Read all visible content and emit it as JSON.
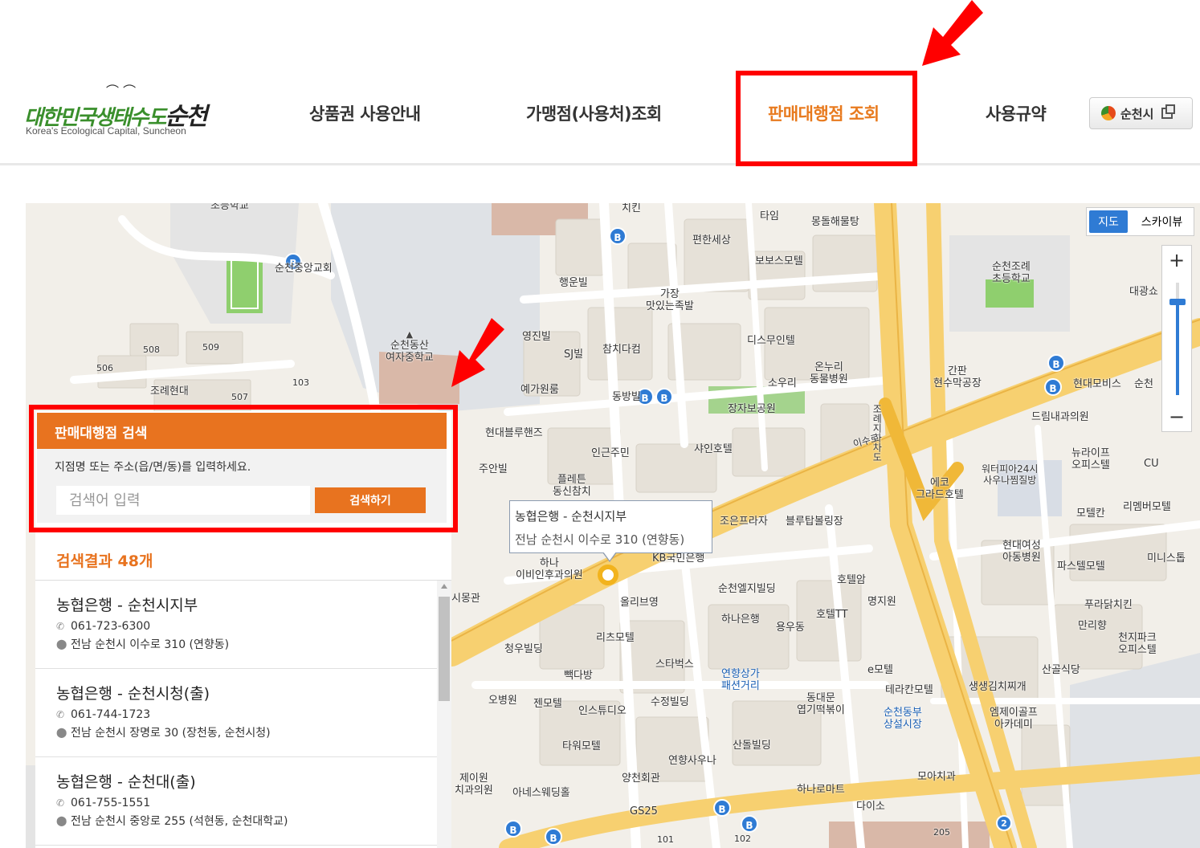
{
  "header": {
    "logo": {
      "title_green": "대한민국생태수도",
      "title_dark": "순천",
      "subtitle": "Korea's Ecological Capital, Suncheon"
    },
    "nav": [
      {
        "label": "상품권 사용안내"
      },
      {
        "label": "가맹점(사용처)조회"
      },
      {
        "label": "판매대행점 조회"
      },
      {
        "label": "사용규약"
      }
    ],
    "city_button": "순천시"
  },
  "map": {
    "map_types": [
      "지도",
      "스카이뷰"
    ],
    "zoom_in": "+",
    "zoom_out": "−",
    "info_window": {
      "title": "농협은행 - 순천시지부",
      "address": "전남 순천시 이수로 310 (연향동)"
    },
    "labels": [
      "초등학교",
      "순천동산\n여자중학교",
      "순천중앙교회",
      "508",
      "509",
      "506",
      "507",
      "103",
      "조례현대",
      "행운빌",
      "영진빌",
      "SJ빌",
      "예가원룸",
      "가장\n맛있는족발",
      "참치다컴",
      "동방빌",
      "현대블루핸즈",
      "주안빌",
      "인근주민",
      "플레튼\n동신참치",
      "하나\n이비인후과의원",
      "올리브영",
      "리츠모텔",
      "청우빌딩",
      "빽다방",
      "스타벅스",
      "오병원",
      "젠모텔",
      "인스튜디오",
      "수정빌딩",
      "타워모텔",
      "연향사우나",
      "산돌빌딩",
      "양천회관",
      "GS25",
      "아네스웨딩홀",
      "제이원\n치과의원",
      "편한세상",
      "타임",
      "몽돌해물탕",
      "보보스모텔",
      "디스무인텔",
      "소우리",
      "온누리\n동물병원",
      "장자보공원",
      "샤인호텔",
      "조은프라자",
      "블루탑볼링장",
      "KB국민은행",
      "순천엘지빌딩",
      "호텔암",
      "하나은행",
      "용우동",
      "호텔TT",
      "명지원",
      "연향상가\n패션거리",
      "e모텔",
      "동대문\n엽기떡볶이",
      "테라칸모텔",
      "순천동부\n상설시장",
      "하나로마트",
      "다이소",
      "순천조례\n초등학교",
      "대광쇼",
      "간판\n현수막공장",
      "현대모비스",
      "순천",
      "드림내과의원",
      "뉴라이프\n오피스텔",
      "CU",
      "워터피아24시\n사우나찜질방",
      "에코\n그라드호텔",
      "모텔칸",
      "리멤버모텔",
      "현대여성\n아동병원",
      "파스텔모텔",
      "미니스톱",
      "푸라닭치킨",
      "만리향",
      "천지파크\n오피스텔",
      "산골식당",
      "생생김치찌개",
      "엠제이골프\n아카데미",
      "모아치과",
      "조례지하차도",
      "이수로",
      "시몽관",
      "치킨",
      "101",
      "102",
      "205"
    ]
  },
  "search_panel": {
    "title": "판매대행점 검색",
    "description": "지점명 또는 주소(읍/면/동)를 입력하세요.",
    "input_placeholder": "검색어 입력",
    "search_button": "검색하기",
    "results_count": "검색결과 48개",
    "results": [
      {
        "name": "농협은행 - 순천시지부",
        "phone": "061-723-6300",
        "address": "전남 순천시 이수로 310 (연향동)"
      },
      {
        "name": "농협은행 - 순천시청(출)",
        "phone": "061-744-1723",
        "address": "전남 순천시 장명로 30 (장천동, 순천시청)"
      },
      {
        "name": "농협은행 - 순천대(출)",
        "phone": "061-755-1551",
        "address": "전남 순천시 중앙로 255 (석현동, 순천대학교)"
      }
    ]
  },
  "colors": {
    "accent": "#e8731f",
    "highlight_red": "#ff0000",
    "map_blue": "#2f7bd4"
  }
}
